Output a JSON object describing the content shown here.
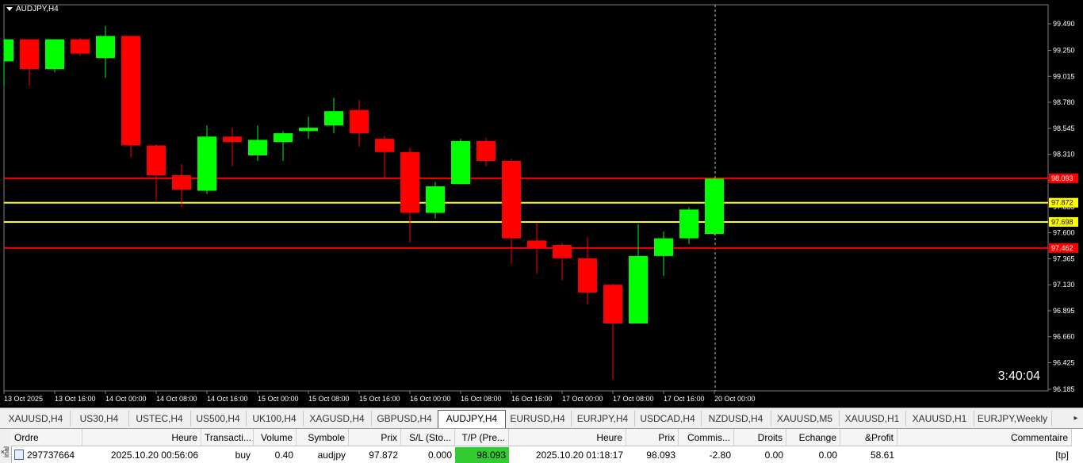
{
  "chart": {
    "title": "AUDJPY,H4",
    "countdown": "3:40:04",
    "price_min": 96.185,
    "price_max": 99.49,
    "y_ticks": [
      "99.490",
      "99.250",
      "99.015",
      "98.780",
      "98.545",
      "98.310",
      "98.075",
      "97.835",
      "97.600",
      "97.365",
      "97.130",
      "96.895",
      "96.660",
      "96.425",
      "96.185"
    ],
    "x_labels": [
      "13 Oct 2025",
      "13 Oct 16:00",
      "14 Oct 00:00",
      "14 Oct 08:00",
      "14 Oct 16:00",
      "15 Oct 00:00",
      "15 Oct 08:00",
      "15 Oct 16:00",
      "16 Oct 00:00",
      "16 Oct 08:00",
      "16 Oct 16:00",
      "17 Oct 00:00",
      "17 Oct 08:00",
      "17 Oct 16:00",
      "20 Oct 00:00"
    ],
    "hlines": [
      {
        "price": 98.093,
        "label": "98.093",
        "color": "#ff0000"
      },
      {
        "price": 97.872,
        "label": "97.872",
        "color": "#ffff00"
      },
      {
        "price": 97.698,
        "label": "97.698",
        "color": "#ffff00"
      },
      {
        "price": 97.462,
        "label": "97.462",
        "color": "#ff0000"
      }
    ],
    "up_color": "#00ff00",
    "down_color": "#ff0000",
    "candles": [
      {
        "o": 99.15,
        "h": 99.32,
        "l": 98.93,
        "c": 99.35
      },
      {
        "o": 99.35,
        "h": 99.35,
        "l": 98.93,
        "c": 99.08
      },
      {
        "o": 99.08,
        "h": 99.35,
        "l": 99.05,
        "c": 99.35
      },
      {
        "o": 99.35,
        "h": 99.36,
        "l": 99.2,
        "c": 99.22
      },
      {
        "o": 99.18,
        "h": 99.47,
        "l": 99.0,
        "c": 99.38
      },
      {
        "o": 99.38,
        "h": 99.38,
        "l": 98.28,
        "c": 98.39
      },
      {
        "o": 98.39,
        "h": 98.4,
        "l": 97.9,
        "c": 98.12
      },
      {
        "o": 98.12,
        "h": 98.22,
        "l": 97.83,
        "c": 97.99
      },
      {
        "o": 97.98,
        "h": 98.57,
        "l": 97.95,
        "c": 98.47
      },
      {
        "o": 98.47,
        "h": 98.55,
        "l": 98.2,
        "c": 98.42
      },
      {
        "o": 98.3,
        "h": 98.57,
        "l": 98.25,
        "c": 98.44
      },
      {
        "o": 98.42,
        "h": 98.52,
        "l": 98.25,
        "c": 98.5
      },
      {
        "o": 98.52,
        "h": 98.65,
        "l": 98.45,
        "c": 98.55
      },
      {
        "o": 98.57,
        "h": 98.82,
        "l": 98.5,
        "c": 98.7
      },
      {
        "o": 98.71,
        "h": 98.8,
        "l": 98.38,
        "c": 98.5
      },
      {
        "o": 98.45,
        "h": 98.48,
        "l": 98.1,
        "c": 98.33
      },
      {
        "o": 98.33,
        "h": 98.37,
        "l": 97.51,
        "c": 97.78
      },
      {
        "o": 97.78,
        "h": 98.06,
        "l": 97.73,
        "c": 98.02
      },
      {
        "o": 98.04,
        "h": 98.45,
        "l": 98.04,
        "c": 98.43
      },
      {
        "o": 98.43,
        "h": 98.46,
        "l": 98.2,
        "c": 98.25
      },
      {
        "o": 98.25,
        "h": 98.27,
        "l": 97.32,
        "c": 97.55
      },
      {
        "o": 97.53,
        "h": 97.69,
        "l": 97.23,
        "c": 97.46
      },
      {
        "o": 97.49,
        "h": 97.51,
        "l": 97.17,
        "c": 97.37
      },
      {
        "o": 97.37,
        "h": 97.56,
        "l": 96.95,
        "c": 97.06
      },
      {
        "o": 97.13,
        "h": 97.14,
        "l": 96.27,
        "c": 96.78
      },
      {
        "o": 96.78,
        "h": 97.68,
        "l": 96.78,
        "c": 97.39
      },
      {
        "o": 97.39,
        "h": 97.61,
        "l": 97.21,
        "c": 97.55
      },
      {
        "o": 97.55,
        "h": 97.83,
        "l": 97.5,
        "c": 97.81
      },
      {
        "o": 97.59,
        "h": 98.1,
        "l": 97.58,
        "c": 98.09
      }
    ]
  },
  "tabs": [
    "XAUUSD,H4",
    "US30,H4",
    "USTEC,H4",
    "US500,H4",
    "UK100,H4",
    "XAGUSD,H4",
    "GBPUSD,H4",
    "AUDJPY,H4",
    "EURUSD,H4",
    "EURJPY,H4",
    "USDCAD,H4",
    "NZDUSD,H4",
    "XAUUSD,M5",
    "XAUUSD,H1",
    "XAUUSD,H1",
    "EURJPY,Weekly"
  ],
  "active_tab": "AUDJPY,H4",
  "terminal": {
    "side_label": "inal",
    "headers": [
      "Ordre",
      "Heure",
      "Transacti...",
      "Volume",
      "Symbole",
      "Prix",
      "S/L (Sto...",
      "T/P (Pre...",
      "Heure",
      "Prix",
      "Commis...",
      "Droits",
      "Echange",
      "&Profit",
      "Commentaire"
    ],
    "row": [
      "297737664",
      "2025.10.20 00:56:06",
      "buy",
      "0.40",
      "audjpy",
      "97.872",
      "0.000",
      "98.093",
      "2025.10.20 01:18:17",
      "98.093",
      "-2.80",
      "0.00",
      "0.00",
      "58.61",
      "[tp]"
    ],
    "tp_highlight": "#33cc33"
  }
}
